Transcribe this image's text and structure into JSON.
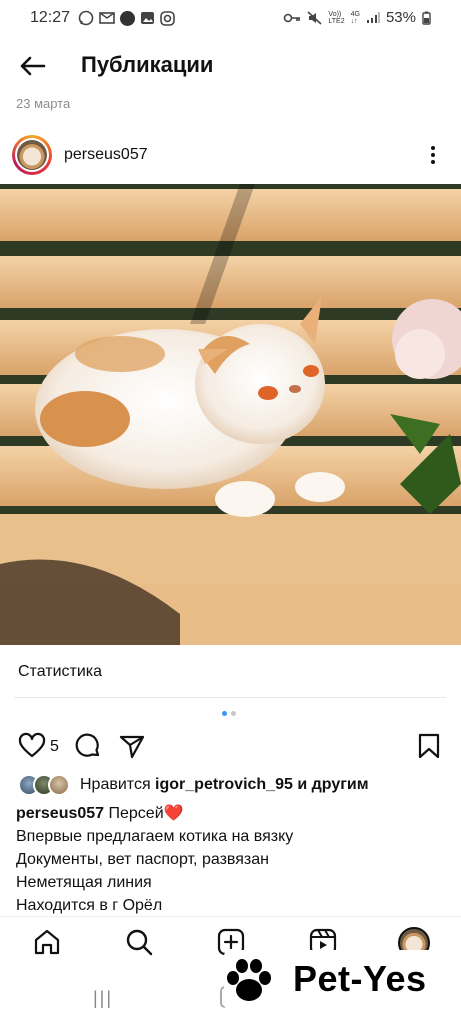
{
  "status_bar": {
    "time": "12:27",
    "network_top": "Vo))",
    "network_bottom": "LTE2",
    "net_type_top": "4G",
    "battery": "53%"
  },
  "header": {
    "title": "Публикации",
    "date": "23 марта"
  },
  "post": {
    "username": "perseus057",
    "statistics_label": "Статистика",
    "likes_count": "5",
    "liked_by_prefix": "Нравится ",
    "liked_by_user": "igor_petrovich_95",
    "liked_by_suffix": " и другим",
    "caption_user": "perseus057",
    "caption_title": " Персей",
    "caption_emoji": "❤️",
    "caption_lines": [
      "Впервые предлагаем котика на вязку",
      "Документы, вет паспорт, развязан",
      "Неметящая линия",
      "Находится в г Орёл"
    ]
  },
  "watermark": {
    "text": "Pet-Yes"
  },
  "colors": {
    "accent": "#3897f0",
    "heart": "#ed4956"
  }
}
